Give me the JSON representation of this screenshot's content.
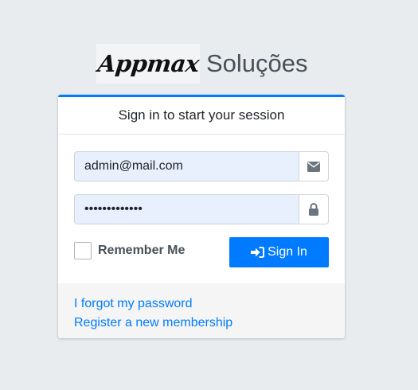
{
  "brand": {
    "logo_text": "Appmax",
    "subtitle": "Soluções"
  },
  "card": {
    "header": "Sign in to start your session"
  },
  "email": {
    "value": "admin@mail.com",
    "icon": "envelope-icon"
  },
  "password": {
    "value": "•••••••••••••",
    "icon": "lock-icon"
  },
  "remember": {
    "label": "Remember Me",
    "checked": false
  },
  "signin": {
    "label": "Sign In",
    "icon": "sign-in-icon"
  },
  "links": {
    "forgot": "I forgot my password",
    "register": "Register a new membership"
  },
  "colors": {
    "accent": "#007bff",
    "background": "#e9ecef",
    "autofill": "#e8f0fe"
  }
}
